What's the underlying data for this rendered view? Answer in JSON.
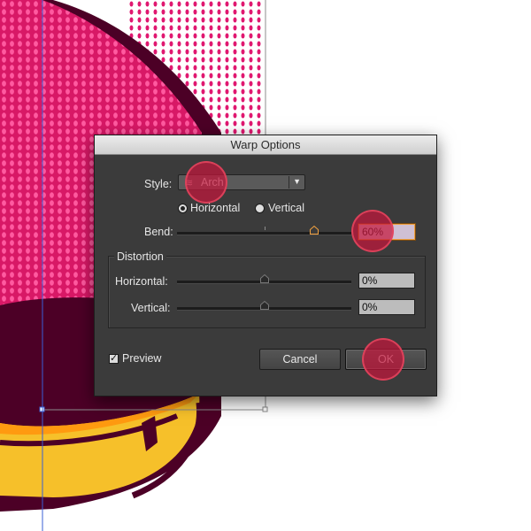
{
  "dialog": {
    "title": "Warp Options",
    "style_label": "Style:",
    "style_value": "Arch",
    "style_icon": "arch-warp-icon",
    "orientation": {
      "horizontal_label": "Horizontal",
      "vertical_label": "Vertical",
      "selected": "Horizontal"
    },
    "bend_label": "Bend:",
    "bend_value": "60%",
    "distortion": {
      "title": "Distortion",
      "horizontal_label": "Horizontal:",
      "horizontal_value": "0%",
      "vertical_label": "Vertical:",
      "vertical_value": "0%"
    },
    "preview_label": "Preview",
    "preview_checked": true,
    "cancel_label": "Cancel",
    "ok_label": "OK"
  },
  "colors": {
    "artwork_magenta": "#d81866",
    "artwork_dot": "#ff5aa0",
    "artwork_maroon": "#4c0026",
    "artwork_yellow": "#f6c02a",
    "guide_blue": "#3a5fd6",
    "marker_red": "#c4163c"
  }
}
